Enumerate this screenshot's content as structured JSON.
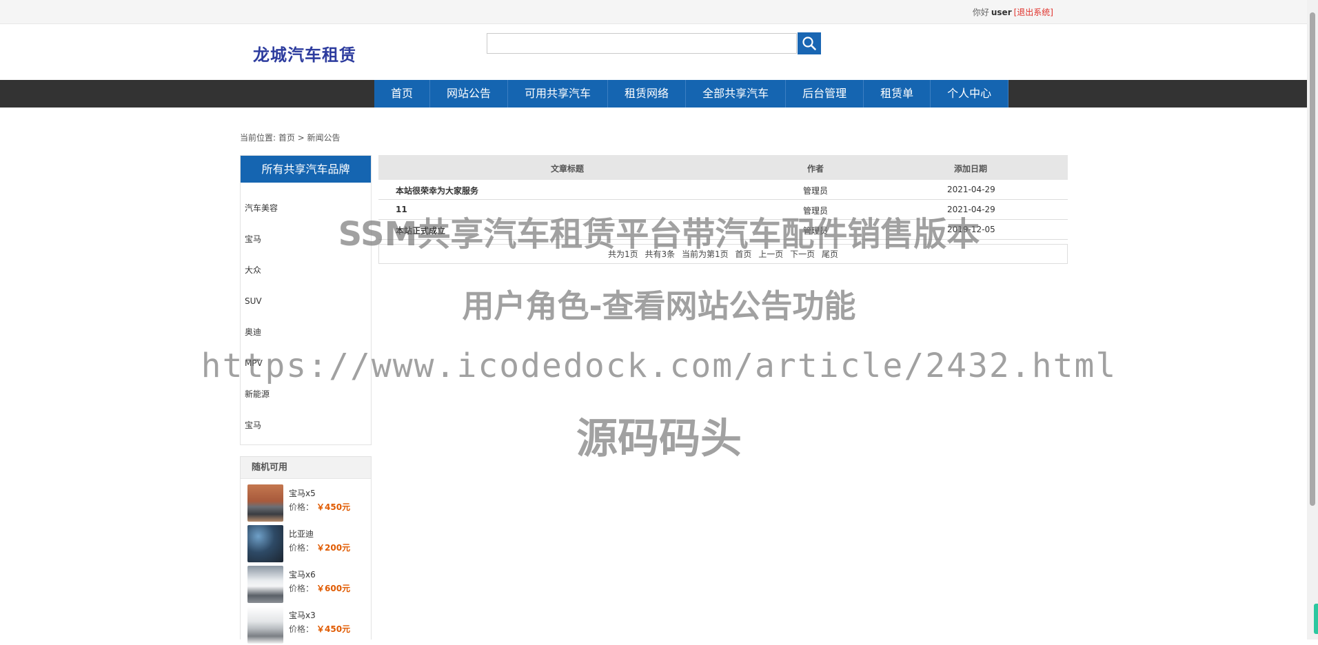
{
  "topbar": {
    "greeting": "你好",
    "username": "user",
    "logout": "[退出系统]"
  },
  "header": {
    "logo": "龙城汽车租赁",
    "search_placeholder": "",
    "search_icon": "search-icon"
  },
  "nav": [
    {
      "label": "首页"
    },
    {
      "label": "网站公告"
    },
    {
      "label": "可用共享汽车"
    },
    {
      "label": "租赁网络"
    },
    {
      "label": "全部共享汽车"
    },
    {
      "label": "后台管理"
    },
    {
      "label": "租赁单"
    },
    {
      "label": "个人中心"
    }
  ],
  "breadcrumb": "当前位置: 首页 > 新闻公告",
  "sidebar": {
    "brand_title": "所有共享汽车品牌",
    "brands": [
      {
        "label": "汽车美容"
      },
      {
        "label": "宝马"
      },
      {
        "label": "大众"
      },
      {
        "label": "SUV"
      },
      {
        "label": "奥迪"
      },
      {
        "label": "MPV"
      },
      {
        "label": "新能源"
      },
      {
        "label": "宝马"
      }
    ],
    "random_title": "随机可用",
    "price_label": "价格：",
    "cars": [
      {
        "name": "宝马x5",
        "price": "￥450元",
        "color": "#b36a4a"
      },
      {
        "name": "比亚迪",
        "price": "￥200元",
        "color": "#2e4a66"
      },
      {
        "name": "宝马x6",
        "price": "￥600元",
        "color": "#6f7d8c"
      },
      {
        "name": "宝马x3",
        "price": "￥450元",
        "color": "#c9ccd0"
      }
    ]
  },
  "table": {
    "headers": {
      "title": "文章标题",
      "author": "作者",
      "date": "添加日期"
    },
    "rows": [
      {
        "title": "本站很荣幸为大家服务",
        "author": "管理员",
        "date": "2021-04-29"
      },
      {
        "title": "11",
        "author": "管理员",
        "date": "2021-04-29"
      },
      {
        "title": "本站正式成立",
        "author": "管理员",
        "date": "2019-12-05"
      }
    ]
  },
  "pager": {
    "total_pages": "共为1页",
    "total_items": "共有3条",
    "current": "当前为第1页",
    "first": "首页",
    "prev": "上一页",
    "next": "下一页",
    "last": "尾页"
  },
  "watermark": {
    "line1": "SSM共享汽车租赁平台带汽车配件销售版本",
    "line2": "用户角色-查看网站公告功能",
    "line3": "https://www.icodedock.com/article/2432.html",
    "line4": "源码码头"
  },
  "colors": {
    "accent": "#1565b1",
    "nav_bg": "#333333",
    "price": "#e05a00",
    "logout": "#e0322c",
    "logo": "#2d3c9e"
  }
}
